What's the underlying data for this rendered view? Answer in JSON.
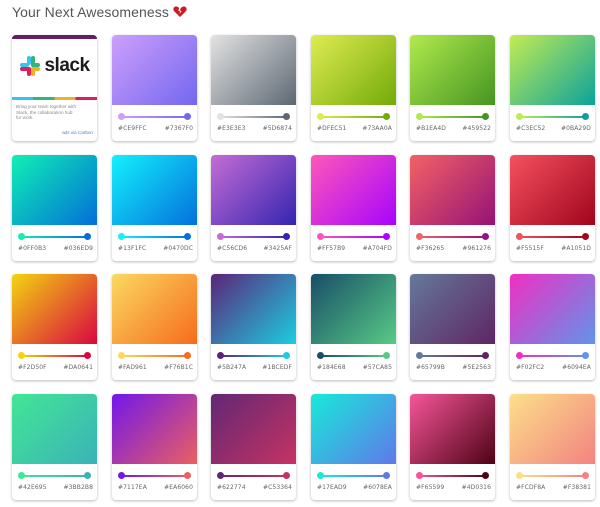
{
  "header": {
    "title": "Your Next Awesomeness",
    "heart_icon": "broken-heart-icon"
  },
  "ad": {
    "brand": "slack",
    "text": "Bring your team together with Slack, the collaboration hub for work.",
    "credit": "ads via Carbon"
  },
  "gradients": [
    {
      "from": "#CE9FFC",
      "to": "#7367F0"
    },
    {
      "from": "#E3E3E3",
      "to": "#5D6874"
    },
    {
      "from": "#DFEC51",
      "to": "#73AA0A"
    },
    {
      "from": "#B1EA4D",
      "to": "#459522"
    },
    {
      "from": "#C3EC52",
      "to": "#0BA29D"
    },
    {
      "from": "#0FF0B3",
      "to": "#036ED9"
    },
    {
      "from": "#13F1FC",
      "to": "#0470DC"
    },
    {
      "from": "#C56CD6",
      "to": "#3425AF"
    },
    {
      "from": "#FF57B9",
      "to": "#A704FD"
    },
    {
      "from": "#F36265",
      "to": "#961276"
    },
    {
      "from": "#F5515F",
      "to": "#A1051D"
    },
    {
      "from": "#F2D50F",
      "to": "#DA0641"
    },
    {
      "from": "#FAD961",
      "to": "#F76B1C"
    },
    {
      "from": "#5B247A",
      "to": "#1BCEDF"
    },
    {
      "from": "#184E68",
      "to": "#57CA85"
    },
    {
      "from": "#65799B",
      "to": "#5E2563"
    },
    {
      "from": "#F02FC2",
      "to": "#6094EA"
    },
    {
      "from": "#42E695",
      "to": "#3BB2B8"
    },
    {
      "from": "#7117EA",
      "to": "#EA6060"
    },
    {
      "from": "#622774",
      "to": "#C53364"
    },
    {
      "from": "#17EAD9",
      "to": "#6078EA"
    },
    {
      "from": "#F65599",
      "to": "#4D0316"
    },
    {
      "from": "#FCDF8A",
      "to": "#F38381"
    }
  ]
}
